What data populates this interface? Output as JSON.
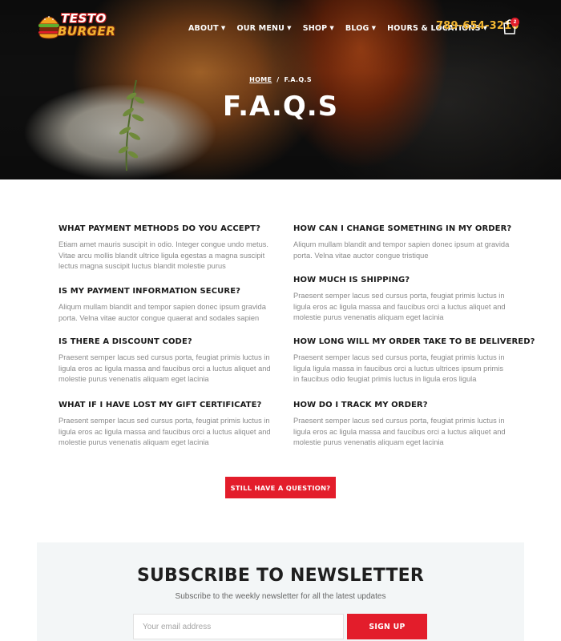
{
  "brand": {
    "line1": "TESTO",
    "line2": "BURGER"
  },
  "nav": {
    "items": [
      {
        "label": "ABOUT"
      },
      {
        "label": "OUR MENU"
      },
      {
        "label": "SHOP"
      },
      {
        "label": "BLOG"
      },
      {
        "label": "HOURS & LOCATIONS"
      }
    ],
    "phone": "789-654-3210",
    "cart_count": "2"
  },
  "hero": {
    "breadcrumb": {
      "home": "HOME",
      "separator": "/",
      "current": "F.A.Q.S"
    },
    "title": "F.A.Q.S"
  },
  "faq": {
    "left": [
      {
        "q": "WHAT PAYMENT METHODS DO YOU ACCEPT?",
        "a": "Etiam amet mauris suscipit in odio. Integer congue undo metus. Vitae arcu mollis blandit ultrice ligula egestas a magna suscipit lectus magna suscipit luctus blandit molestie purus"
      },
      {
        "q": "IS MY PAYMENT INFORMATION SECURE?",
        "a": "Aliqum mullam blandit and tempor sapien donec ipsum gravida porta. Velna vitae auctor congue quaerat and sodales sapien"
      },
      {
        "q": "IS THERE A DISCOUNT CODE?",
        "a": "Praesent semper lacus sed cursus porta, feugiat primis luctus in ligula eros ac ligula massa and faucibus orci a luctus aliquet and molestie purus venenatis aliquam eget lacinia"
      },
      {
        "q": "WHAT IF I HAVE LOST MY GIFT CERTIFICATE?",
        "a": "Praesent semper lacus sed cursus porta, feugiat primis luctus in ligula eros ac ligula massa and faucibus orci a luctus aliquet and molestie purus venenatis aliquam eget lacinia"
      }
    ],
    "right": [
      {
        "q": "HOW CAN I CHANGE SOMETHING IN MY ORDER?",
        "a": "Aliqum mullam blandit and tempor sapien donec ipsum at gravida porta. Velna vitae auctor congue tristique"
      },
      {
        "q": "HOW MUCH IS SHIPPING?",
        "a": "Praesent semper lacus sed cursus porta, feugiat primis luctus in ligula eros ac ligula massa and faucibus orci a luctus aliquet and molestie purus venenatis aliquam eget lacinia"
      },
      {
        "q": "HOW LONG WILL MY ORDER TAKE TO BE DELIVERED?",
        "a": "Praesent semper lacus sed cursus porta, feugiat primis luctus in ligula ligula massa in faucibus orci a luctus ultrices ipsum primis in faucibus odio feugiat primis luctus in ligula eros ligula"
      },
      {
        "q": "HOW DO I TRACK MY ORDER?",
        "a": "Praesent semper lacus sed cursus porta, feugiat primis luctus in ligula eros ac ligula massa and faucibus orci a luctus aliquet and molestie purus venenatis aliquam eget lacinia"
      }
    ],
    "cta_label": "STILL HAVE A QUESTION?"
  },
  "newsletter": {
    "title": "SUBSCRIBE TO NEWSLETTER",
    "subtitle": "Subscribe to the weekly newsletter for all the latest updates",
    "email_placeholder": "Your email address",
    "button_label": "SIGN UP"
  },
  "colors": {
    "accent": "#e31d2b",
    "phone": "#f3b632",
    "newsletter_bg": "#f3f6f7"
  }
}
